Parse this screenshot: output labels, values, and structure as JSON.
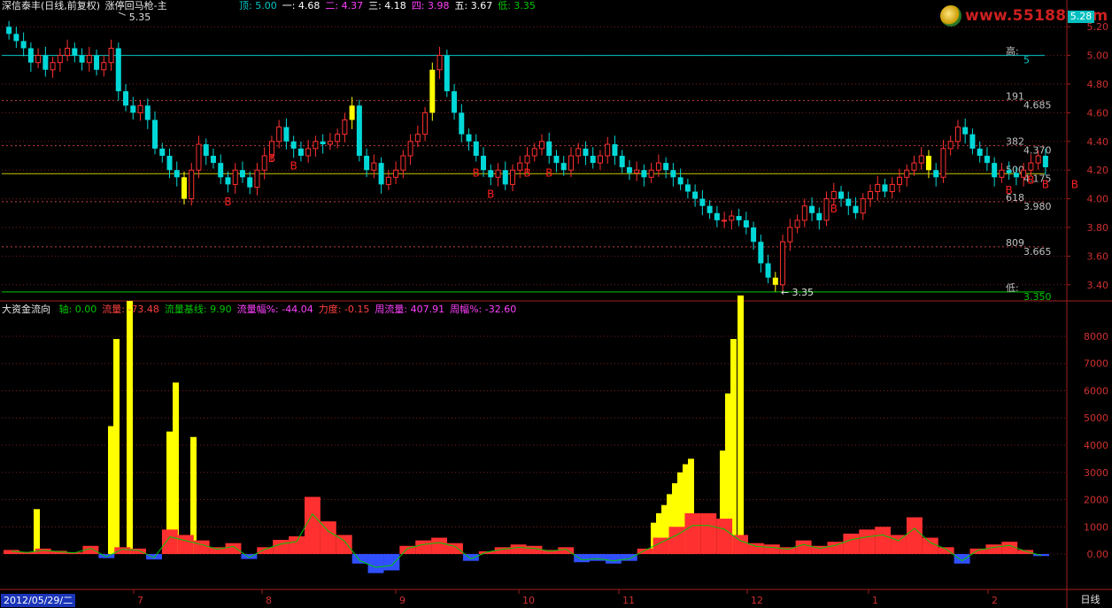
{
  "header": {
    "stock_title": "深信泰丰(日线,前复权)",
    "indicator_name": "涨停回马枪-主",
    "levels": [
      {
        "label": "顶:",
        "value": "5.00",
        "color": "#00c8c8"
      },
      {
        "label": "一:",
        "value": "4.68",
        "color": "#ffffff"
      },
      {
        "label": "二:",
        "value": "4.37",
        "color": "#ff40ff"
      },
      {
        "label": "三:",
        "value": "4.18",
        "color": "#ffffff"
      },
      {
        "label": "四:",
        "value": "3.98",
        "color": "#ff40ff"
      },
      {
        "label": "五:",
        "value": "3.67",
        "color": "#ffffff"
      },
      {
        "label": "低:",
        "value": "3.35",
        "color": "#00c800"
      }
    ],
    "cross_mark": "××",
    "single_mark": "×"
  },
  "watermark": {
    "site_text": "www.55188.com"
  },
  "current_price_tag": "5.28",
  "price_panel": {
    "y_ticks": [
      "5.20",
      "5.00",
      "4.80",
      "4.60",
      "4.40",
      "4.20",
      "4.00",
      "3.80",
      "3.60",
      "3.40"
    ],
    "peak_label": "5.35",
    "trough_label": "3.35",
    "fib_labels": [
      {
        "name": "高:",
        "value": "5",
        "price": 5.0,
        "line": "#00c8c8"
      },
      {
        "name": "191",
        "value": "4.685",
        "price": 4.685,
        "line": "#c04040"
      },
      {
        "name": "382",
        "value": "4.370",
        "price": 4.37,
        "line": "#c04040"
      },
      {
        "name": "500",
        "value": "4.175",
        "price": 4.175,
        "line": "#c8c800"
      },
      {
        "name": "618",
        "value": "3.980",
        "price": 3.98,
        "line": "#c04040"
      },
      {
        "name": "809",
        "value": "3.665",
        "price": 3.665,
        "line": "#c04040"
      },
      {
        "name": "低:",
        "value": "3.350",
        "price": 3.35,
        "line": "#00c800"
      }
    ],
    "signal_letter": "B"
  },
  "flow_panel": {
    "title": "大资金流向",
    "items": [
      {
        "label": "轴:",
        "value": "0.00",
        "color": "#00c800"
      },
      {
        "label": "流量:",
        "value": "-73.48",
        "color": "#ff4040"
      },
      {
        "label": "流量基线:",
        "value": "9.90",
        "color": "#00c800"
      },
      {
        "label": "流量幅%:",
        "value": "-44.04",
        "color": "#ff40ff"
      },
      {
        "label": "力度:",
        "value": "-0.15",
        "color": "#ff4040"
      },
      {
        "label": "周流量:",
        "value": "407.91",
        "color": "#ff40ff"
      },
      {
        "label": "周幅%:",
        "value": "-32.60",
        "color": "#ff40ff"
      }
    ],
    "y_ticks": [
      "8000",
      "7000",
      "6000",
      "5000",
      "4000",
      "3000",
      "2000",
      "1000",
      "0.00"
    ]
  },
  "footer": {
    "current_date": "2012/05/29/二",
    "months": [
      "7",
      "8",
      "9",
      "10",
      "11",
      "12",
      "1",
      "2"
    ],
    "period_button": "日线"
  },
  "colors": {
    "up": "#ff3030",
    "down": "#00d8d8",
    "limit_up_bar": "#ffff00",
    "outflow": "#3050ff",
    "grid": "#7a1e1e",
    "axis": "#a02020",
    "ma": "#00c800",
    "signal": "#ff2020"
  },
  "chart_data": [
    {
      "type": "candlestick",
      "title": "深信泰丰(日线,前复权)",
      "ylim": [
        3.3,
        5.3
      ],
      "x": [
        "2012-05-29",
        "2012-07",
        "2012-08",
        "2012-09",
        "2012-10",
        "2012-11",
        "2012-12",
        "2013-01",
        "2013-02"
      ],
      "close_path_approx": [
        5.15,
        5.1,
        5.05,
        4.95,
        5.0,
        4.9,
        4.95,
        5.0,
        5.05,
        5.0,
        4.95,
        5.0,
        4.9,
        4.95,
        5.05,
        4.75,
        4.65,
        4.6,
        4.65,
        4.55,
        4.35,
        4.3,
        4.2,
        4.15,
        4.0,
        4.2,
        4.38,
        4.3,
        4.25,
        4.15,
        4.1,
        4.2,
        4.15,
        4.08,
        4.2,
        4.3,
        4.4,
        4.5,
        4.4,
        4.35,
        4.3,
        4.35,
        4.4,
        4.38,
        4.4,
        4.45,
        4.55,
        4.65,
        4.3,
        4.2,
        4.25,
        4.1,
        4.15,
        4.2,
        4.3,
        4.4,
        4.45,
        4.6,
        4.9,
        5.0,
        4.75,
        4.6,
        4.45,
        4.4,
        4.3,
        4.2,
        4.15,
        4.2,
        4.1,
        4.2,
        4.25,
        4.3,
        4.35,
        4.4,
        4.3,
        4.25,
        4.2,
        4.3,
        4.35,
        4.3,
        4.25,
        4.3,
        4.38,
        4.3,
        4.22,
        4.18,
        4.2,
        4.15,
        4.2,
        4.25,
        4.2,
        4.15,
        4.1,
        4.05,
        4.0,
        3.95,
        3.9,
        3.85,
        3.85,
        3.88,
        3.85,
        3.8,
        3.7,
        3.55,
        3.45,
        3.4,
        3.7,
        3.8,
        3.85,
        3.95,
        3.9,
        3.85,
        4.0,
        4.05,
        4.0,
        3.95,
        3.9,
        4.0,
        4.05,
        4.1,
        4.05,
        4.1,
        4.15,
        4.2,
        4.25,
        4.3,
        4.2,
        4.15,
        4.35,
        4.4,
        4.5,
        4.45,
        4.35,
        4.3,
        4.25,
        4.15,
        4.2,
        4.18,
        4.15,
        4.2,
        4.25,
        4.3,
        4.22
      ],
      "reference_lines": [
        5.0,
        4.685,
        4.37,
        4.175,
        3.98,
        3.665,
        3.35
      ],
      "high_label": 5.35,
      "low_label": 3.35
    },
    {
      "type": "bar",
      "title": "大资金流向",
      "ylim": [
        -1300,
        9300
      ],
      "y_ticks": [
        0,
        1000,
        2000,
        3000,
        4000,
        5000,
        6000,
        7000,
        8000
      ],
      "yellow_bars_approx": [
        1650,
        4700,
        7900,
        9300,
        4500,
        6300,
        4300,
        1150,
        1500,
        1800,
        2200,
        2600,
        3000,
        3300,
        3500,
        3800,
        5900,
        7900,
        9500
      ],
      "flow_series_approx": [
        150,
        80,
        200,
        120,
        60,
        300,
        -150,
        250,
        200,
        -200,
        900,
        700,
        500,
        250,
        400,
        -180,
        250,
        520,
        650,
        2100,
        1200,
        700,
        -350,
        -700,
        -600,
        300,
        500,
        600,
        400,
        -250,
        100,
        250,
        350,
        300,
        150,
        250,
        -300,
        -250,
        -350,
        -250,
        200,
        600,
        1000,
        1500,
        1500,
        1300,
        700,
        400,
        350,
        250,
        500,
        300,
        450,
        750,
        900,
        1000,
        700,
        1350,
        600,
        250,
        -350,
        200,
        350,
        450,
        150,
        -73.48
      ]
    }
  ]
}
